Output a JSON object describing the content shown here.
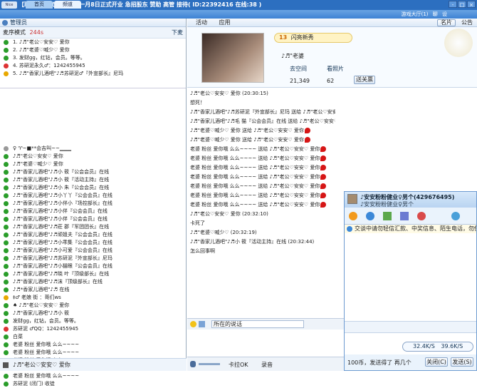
{
  "title_bar": {
    "text": "【聊吧】'香家儿酒吧。 一月8日正式开业 急招股东 赞助 高管 接待( ID:22392416 在线:38 )",
    "logo": "Nice 2015"
  },
  "tabs": [
    {
      "label": "首页"
    },
    {
      "label": "频道"
    }
  ],
  "top_right": {
    "hall": "游戏大厅(1)",
    "mode": "聊",
    "settings": "设",
    "window_controls": [
      "-",
      "□",
      "×"
    ]
  },
  "admin": {
    "label": "管理员"
  },
  "mic": {
    "mode_label": "麦序模式",
    "count": "244s",
    "down_label": "下麦"
  },
  "queue": [
    "1. ♪♬\"老公♡安安♡ 爱你",
    "2. ♪♬\"老婆♡喊少♡ 爱你",
    "3. 发财gg，红钻，会员。等等。",
    "4. 苏研泥永久♂：1242455945",
    "5. ♪♬\"香家儿酒吧\"♪♬苏研泥♂『外宣部长』尼玛"
  ],
  "members": [
    "♀ ♈~■**会吉叫~~▁▁▁",
    "♪♬\"老公♡安安♡ 爱你",
    "♪♬\"老婆♡喊少♡ 爱你",
    "♪♬\"香家儿酒吧\"♪♬小 筱『公会会员』在线",
    "♪♬\"香家儿酒吧\"♪♬小 筱『活动主持』在线",
    "♪♬\"香家儿酒吧\"♪♬小 朱『公会会员』在线",
    "♪♬\"香家儿酒吧\"♪♬小丫丫『公会会员』在线",
    "♪♬\"香家儿酒吧\"♪♬小伴小『场控部长』在线",
    "♪♬\"香家儿酒吧\"♪♬小伴『公会会员』在线",
    "♪♬\"香家儿酒吧\"♪♬小伴『公会会员』在线",
    "♪♬\"香家儿酒吧\"♪♬莊 郡『军团团长』在线",
    "♪♬\"香家儿酒吧\"♪♬顽姐夫『公会会员』在线",
    "♪♬\"香家儿酒吧\"♪♬小乖集『公会会员』在线",
    "♪♬\"香家儿酒吧\"♪♬小可爱『公会会员』在线",
    "♪♬\"香家儿酒吧\"♪♬苏研泥『外宣部长』尼玛",
    "♪♬\"香家儿酒吧\"♪♬小猫眼『公会会员』在线",
    "♪♬\"香家儿酒吧\"♪♬晓 叶『顶级部长』在线",
    "♪♬\"香家儿酒吧\"♪♬沫『顶级部长』在线",
    "♪♬*香家儿酒吧\"♪♬ 在线",
    "‡♂ 老娘 街 ：哥们ws",
    "♠ ♪♬\"老公♡安安♡ 爱你",
    "♪♬\"香家儿酒吧\"♪♬小 筱",
    "发财gg，红钻，会员。等等。",
    "苏研泥 ♂QQ：1242455945",
    "白菜",
    "老婆 粉丝 爱你哦 么么~~~~",
    "老婆 粉丝 爱你哦 么么~~~~",
    "老婆 粉丝 爱你哦 么么~~~~",
    "老婆 粉丝 爱你哦 么么~~~~",
    "老婆 粉丝 爱你哦 么么~~~~",
    "苏研泥 (闭门) 收徒"
  ],
  "self_line": "♪♬\"老公♡安安♡ 爱你",
  "mid_toolbar": {
    "activity": "活动",
    "apps": "应用",
    "card": "名片",
    "notice": "公告"
  },
  "profile": {
    "level": "13",
    "name": "闪亮新秀",
    "nick": "♪♬\"老婆",
    "space": "去空间",
    "photos": "看照片",
    "flowers": "21,349",
    "points": "62",
    "follow": "送关票"
  },
  "chat": [
    "♪♬\"老公♡安安♡ 爱你 (20:30:15)",
    "想死！",
    "♪♬\"香家儿酒吧\"♪♬苏研泥『外宣部长』尼玛 送给 ♪♬\"老公♡安安♡ 爱你",
    "♪♬\"香家儿酒吧\"♪♬毛 猫『公会会员』在线 送给 ♪♬\"老公♡安安♡ 爱你",
    "♪♬\"老婆♡喊少♡ 爱你 送给 ♪♬\"老公♡安安♡ 爱你",
    "♪♬\"老婆♡喊少♡ 爱你 送给 ♪♬\"老公♡安安♡ 爱你",
    "老婆 粉丝 爱你哦 么么~~~~ 送给 ♪♬\"老公♡安安♡ 爱你",
    "老婆 粉丝 爱你哦 么么~~~~ 送给 ♪♬\"老公♡安安♡ 爱你",
    "老婆 粉丝 爱你哦 么么~~~~ 送给 ♪♬\"老公♡安安♡ 爱你",
    "老婆 粉丝 爱你哦 么么~~~~ 送给 ♪♬\"老公♡安安♡ 爱你",
    "老婆 粉丝 爱你哦 么么~~~~ 送给 ♪♬\"老公♡安安♡ 爱你",
    "老婆 粉丝 爱你哦 么么~~~~ 送给 ♪♬\"老公♡安安♡ 爱你",
    "老婆 粉丝 爱你哦 么么~~~~ 送给 ♪♬\"老公♡安安♡ 爱你",
    "♪♬\"老公♡安安♡ 爱你 (20:32:10)",
    "卡死了",
    "♪♬\"老婆♡喊少♡ (20:32:19)",
    "♪♬\"香家儿酒吧\"♪♬小 筱『活动主持』在线 (20:32:44)",
    "怎么回事啊"
  ],
  "input_placeholder": "所在的说话",
  "bottom": {
    "mic_label": "卡拉OK",
    "record": "录音"
  },
  "qq_window": {
    "title": "♪安安粉粉健业♀男个(429676495)",
    "subtitle": "♪安安粉粉健业♀男个",
    "notice": "交谈中请勿轻信汇款、中奖信息、陌生电话，勿使用外挂软件。",
    "speed_up": "32.4K/S",
    "speed_down": "39.6K/S",
    "close": "关闭(C)",
    "send": "发送(S)",
    "footer": "100币，发送得了 再几个"
  }
}
